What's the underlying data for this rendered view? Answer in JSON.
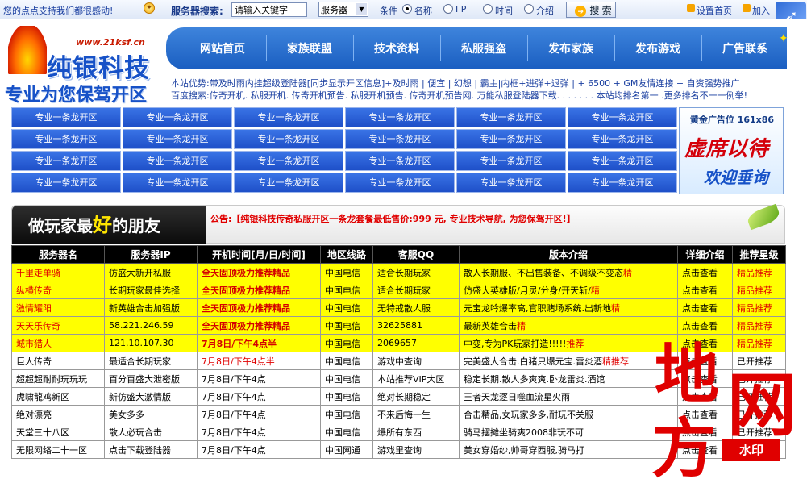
{
  "topbar": {
    "notice": "您的点点支持我们都很感动!",
    "bulb_icon": "lightbulb-icon",
    "search_label": "服务器搜索:",
    "search_input": "请输入关键字",
    "select_value": "服务器",
    "condition_label": "条件",
    "radios": [
      "名称",
      "I P",
      "时间",
      "介绍"
    ],
    "search_button": "搜 索",
    "link_home": "设置首页",
    "link_fav": "加入"
  },
  "header": {
    "logo_url": "www.21ksf.cn",
    "logo_name": "纯银科技",
    "logo_slogan": "专业为您保驾开区",
    "nav": [
      "网站首页",
      "家族联盟",
      "技术资料",
      "私服强盗",
      "发布家族",
      "发布游戏",
      "广告联系"
    ],
    "adv_line1_a": "本站优势:带及时雨内挂超级登陆器[同步显示开区信息]+及时雨 | 便宜 | 幻想 | 霸主|内框+进弹+退弹 | + 6500 + GM友情连接 + 自资强势推广",
    "adv_line2": "百度搜索:传奇开机. 私服开机. 传奇开机预告. 私服开机预告. 传奇开机预告网. 万能私服登陆器下载.  . . . . . . 本站均排名第一 .更多排名不一一例举!"
  },
  "grid": {
    "cells": [
      "专业一条龙开区",
      "专业一条龙开区",
      "专业一条龙开区",
      "专业一条龙开区",
      "专业一条龙开区",
      "专业一条龙开区",
      "专业一条龙开区",
      "专业一条龙开区",
      "专业一条龙开区",
      "专业一条龙开区",
      "专业一条龙开区",
      "专业一条龙开区",
      "专业一条龙开区",
      "专业一条龙开区",
      "专业一条龙开区",
      "专业一条龙开区",
      "专业一条龙开区",
      "专业一条龙开区",
      "专业一条龙开区",
      "专业一条龙开区",
      "专业一条龙开区",
      "专业一条龙开区",
      "专业一条龙开区",
      "专业一条龙开区"
    ]
  },
  "ad": {
    "title": "黄金广告位 161x86",
    "line1": "虚席以待",
    "line2": "欢迎垂询"
  },
  "friends": {
    "title_pre": "做玩家最",
    "title_hi": "好",
    "title_post": "的朋友",
    "announcement": "公告:【纯银科技传奇私服开区一条龙套餐最低售价:999 元, 专业技术导航, 为您保驾开区!】"
  },
  "table": {
    "headers": [
      "服务器名",
      "服务器IP",
      "开机时间[月/日/时间]",
      "地区线路",
      "客服QQ",
      "版本介绍",
      "详细介绍",
      "推荐星级"
    ],
    "rows": [
      {
        "hot": true,
        "name": "千里走单骑",
        "ip": "仿盛大新开私服",
        "time": "全天固顶极力推荐精品",
        "line": "中国电信",
        "qq": "适合长期玩家",
        "intro": "散人长期服、不出售装备、不调级不变态",
        "intro_hi": "精",
        "detail": "点击查看",
        "star": "精品推荐"
      },
      {
        "hot": true,
        "name": "纵横传奇",
        "ip": "长期玩家最佳选择",
        "time": "全天固顶极力推荐精品",
        "line": "中国电信",
        "qq": "适合长期玩家",
        "intro": "仿盛大英雄版/月灵/分身/开天斩/",
        "intro_hi": "精",
        "detail": "点击查看",
        "star": "精品推荐"
      },
      {
        "hot": true,
        "name": "激情耀阳",
        "ip": "新英雄合击加强版",
        "time": "全天固顶极力推荐精品",
        "line": "中国电信",
        "qq": "无特戒散人服",
        "intro": "元宝龙吟爆率高,官职赌场系统.出新地",
        "intro_hi": "精",
        "detail": "点击查看",
        "star": "精品推荐"
      },
      {
        "hot": true,
        "name": "天天乐传奇",
        "ip": "58.221.246.59",
        "time": "全天固顶极力推荐精品",
        "line": "中国电信",
        "qq": "32625881",
        "intro": "最新英雄合击",
        "intro_hi": "精",
        "detail": "点击查看",
        "star": "精品推荐"
      },
      {
        "hot": true,
        "name": "城市猎人",
        "ip": "121.10.107.30",
        "time": "7月8日/下午4点半",
        "line": "中国电信",
        "qq": "2069657",
        "intro": "中变,专为PK玩家打造!!!!!",
        "intro_hi": "推荐",
        "detail": "点击查看",
        "star": "精品推荐"
      },
      {
        "hot": false,
        "name": "巨人传奇",
        "ip": "最适合长期玩家",
        "time": "7月8日/下午4点半",
        "line": "中国电信",
        "qq": "游戏中查询",
        "intro": "完美盛大合击.白猪只爆元宝.雷炎酒",
        "intro_hi": "精推荐",
        "detail": "点击查看",
        "star": "已开推荐"
      },
      {
        "hot": false,
        "name": "超超超耐耐玩玩玩",
        "ip": "百分百盛大泄密版",
        "time": "7月8日/下午4点",
        "line": "中国电信",
        "qq": "本站推荐VIP大区",
        "intro": "稳定长期.散人多爽爽.卧龙雷炎.酒馆",
        "intro_hi": "",
        "detail": "点击查看",
        "star": "已开推荐"
      },
      {
        "hot": false,
        "name": "虎啸龍鸡新区",
        "ip": "新仿盛大激情版",
        "time": "7月8日/下午4点",
        "line": "中国电信",
        "qq": "绝对长期稳定",
        "intro": "王者天龙逐日噬血流星火雨",
        "intro_hi": "",
        "detail": "点击查看",
        "star": "已开推荐"
      },
      {
        "hot": false,
        "name": "绝对漂亮",
        "ip": "美女多多",
        "time": "7月8日/下午4点",
        "line": "中国电信",
        "qq": "不来后悔一生",
        "intro": "合击精品,女玩家多多,耐玩不关服",
        "intro_hi": "",
        "detail": "点击查看",
        "star": "已开推荐"
      },
      {
        "hot": false,
        "name": "天堂三十八区",
        "ip": "散人必玩合击",
        "time": "7月8日/下午4点",
        "line": "中国电信",
        "qq": "爆所有东西",
        "intro": "骑马摆摊坐骑爽2008非玩不可",
        "intro_hi": "",
        "detail": "点击查看",
        "star": "已开推荐"
      },
      {
        "hot": false,
        "name": "无限网络二十一区",
        "ip": "点击下载登陆器",
        "time": "7月8日/下午4点",
        "line": "中国网通",
        "qq": "游戏里查询",
        "intro": "美女穿婚纱,帅哥穿西服,骑马打",
        "intro_hi": "",
        "detail": "点击查看",
        "star": "已开推荐"
      }
    ]
  },
  "watermark": {
    "chars": [
      "地",
      "方",
      "网"
    ],
    "stamp": "水印"
  },
  "colors": {
    "nav_blue": "#1a5ec1",
    "hot_row": "#ffff00",
    "alert_red": "#e00000"
  }
}
